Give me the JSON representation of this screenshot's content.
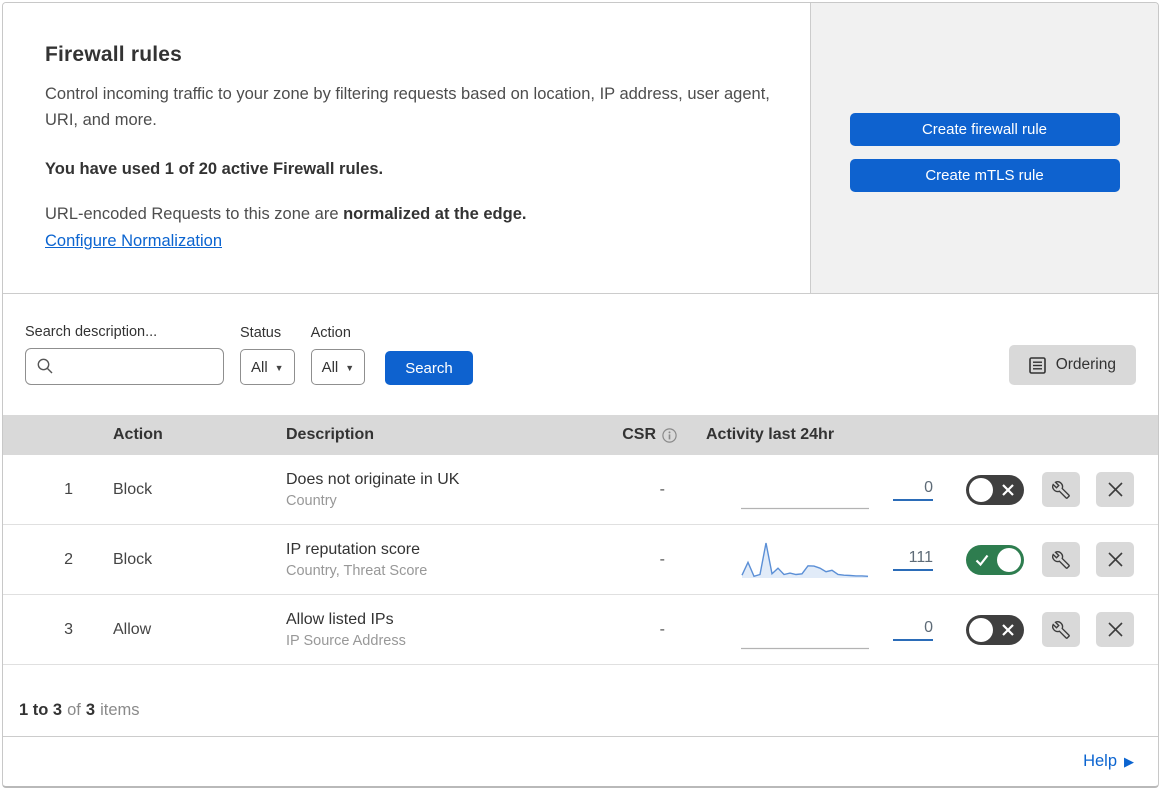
{
  "header": {
    "title": "Firewall rules",
    "description": "Control incoming traffic to your zone by filtering requests based on location, IP address, user agent, URI, and more.",
    "usage": "You have used 1 of 20 active Firewall rules.",
    "normalization_prefix": "URL-encoded Requests to this zone are ",
    "normalization_bold": "normalized at the edge.",
    "normalization_link": "Configure Normalization",
    "create_firewall_label": "Create firewall rule",
    "create_mtls_label": "Create mTLS rule"
  },
  "filters": {
    "search_label": "Search description...",
    "search_value": "",
    "status_label": "Status",
    "status_value": "All",
    "action_label": "Action",
    "action_value": "All",
    "search_button_label": "Search",
    "ordering_button_label": "Ordering"
  },
  "table": {
    "columns": {
      "action": "Action",
      "description": "Description",
      "csr": "CSR",
      "activity": "Activity last 24hr"
    },
    "rows": [
      {
        "index": "1",
        "action": "Block",
        "title": "Does not originate in UK",
        "subtitle": "Country",
        "csr": "-",
        "count": "0",
        "enabled": false,
        "sparkline": []
      },
      {
        "index": "2",
        "action": "Block",
        "title": "IP reputation score",
        "subtitle": "Country, Threat Score",
        "csr": "-",
        "count": "111",
        "enabled": true,
        "sparkline": [
          8,
          45,
          5,
          10,
          100,
          12,
          28,
          10,
          14,
          10,
          12,
          35,
          34,
          28,
          18,
          22,
          10,
          8,
          7,
          6,
          6,
          5
        ]
      },
      {
        "index": "3",
        "action": "Allow",
        "title": "Allow listed IPs",
        "subtitle": "IP Source Address",
        "csr": "-",
        "count": "0",
        "enabled": false,
        "sparkline": []
      }
    ]
  },
  "footer": {
    "range": "1 to 3",
    "of_word": "of",
    "total": "3",
    "items_word": "items",
    "help_label": "Help"
  },
  "colors": {
    "primary_blue": "#0e62cf",
    "link_blue": "#0b64d0",
    "toggle_on_green": "#2e7d4f",
    "toggle_off_gray": "#3f3f3f",
    "sparkline_blue": "#5b8fd6",
    "header_gray": "#d9d9d9",
    "panel_gray": "#f1f1f1"
  }
}
